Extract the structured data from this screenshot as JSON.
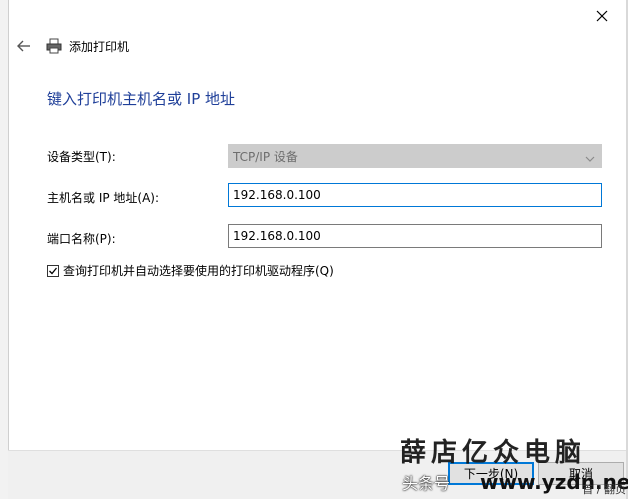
{
  "dialog": {
    "header_title": "添加打印机",
    "page_title": "键入打印机主机名或 IP 地址"
  },
  "form": {
    "device_type_label": "设备类型(T):",
    "device_type_value": "TCP/IP 设备",
    "hostname_label": "主机名或 IP 地址(A):",
    "hostname_value": "192.168.0.100",
    "port_label": "端口名称(P):",
    "port_value": "192.168.0.100",
    "auto_driver_label": "查询打印机并自动选择要使用的打印机驱动程序(Q)",
    "auto_driver_checked": true
  },
  "footer": {
    "next_label": "下一步(N)",
    "cancel_label": "取消"
  },
  "watermark": {
    "line1": "薛店亿众电脑",
    "source": "头条号",
    "url": "www.yzdn.net",
    "corner": "首 / 翻页"
  },
  "colors": {
    "accent": "#0078d7",
    "title": "#1f3f99"
  }
}
